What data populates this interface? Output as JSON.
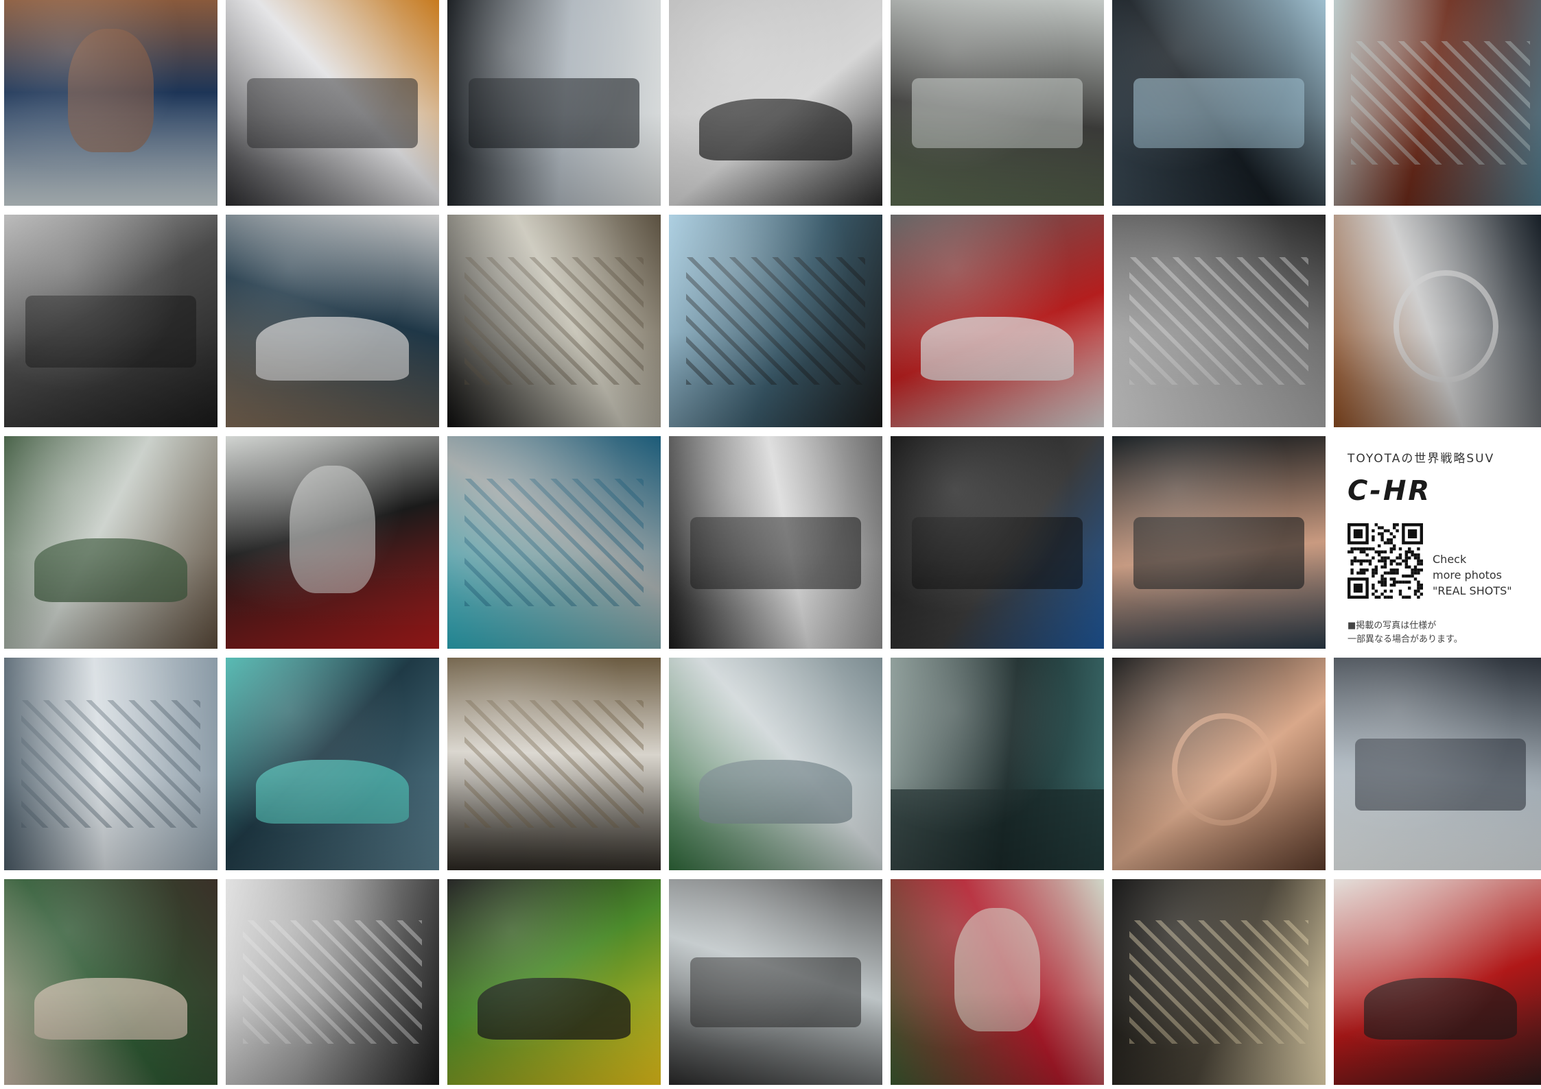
{
  "info_panel": {
    "tagline": "TOYOTAの世界戦略SUV",
    "logo_text": "C-HR",
    "check_lines": [
      "Check",
      "more photos",
      "\"REAL SHOTS\""
    ],
    "note_lines": [
      "■掲載の写真は仕様が",
      "一部異なる場合があります。"
    ]
  },
  "photos": [
    {
      "name": "photo-bearded-man",
      "colors": [
        "#c9d3d6",
        "#1d3557",
        "#8a5a3c"
      ],
      "motif": "portrait"
    },
    {
      "name": "photo-dashboard-airbag-vent",
      "colors": [
        "#2b2b2e",
        "#e2e2e4",
        "#c77a1e"
      ],
      "motif": "interior"
    },
    {
      "name": "photo-driver-window",
      "colors": [
        "#101418",
        "#aeb6bd",
        "#d9dcdc"
      ],
      "motif": "interior"
    },
    {
      "name": "photo-white-chr-open-hatch",
      "colors": [
        "#bdbdbd",
        "#d6d6d6",
        "#2a2a2a"
      ],
      "motif": "car"
    },
    {
      "name": "photo-door-frame-sky",
      "colors": [
        "#c3c8c5",
        "#3c3c3a",
        "#5a6a4f"
      ],
      "motif": "interior"
    },
    {
      "name": "photo-navigation-display",
      "colors": [
        "#9fbfcf",
        "#151c22",
        "#3b4a55"
      ],
      "motif": "interior"
    },
    {
      "name": "photo-wet-hood",
      "colors": [
        "#4d7b8e",
        "#6b2a1a",
        "#b9c8c8"
      ],
      "motif": "detail"
    },
    {
      "name": "photo-steering-wheel",
      "colors": [
        "#1a1a1a",
        "#4a4a4a",
        "#b8b8b8"
      ],
      "motif": "interior"
    },
    {
      "name": "photo-silver-chr-building",
      "colors": [
        "#7f6a55",
        "#1f3747",
        "#c8c8c8"
      ],
      "motif": "car"
    },
    {
      "name": "photo-dotted-headliner",
      "colors": [
        "#0e0e0e",
        "#c8c5b8",
        "#5a5040"
      ],
      "motif": "detail"
    },
    {
      "name": "photo-sky-reflection-hood",
      "colors": [
        "#a9cde0",
        "#3a5a6a",
        "#1a1a1a"
      ],
      "motif": "detail"
    },
    {
      "name": "photo-red-chr-front",
      "colors": [
        "#5c5c5c",
        "#b41e1e",
        "#d6d6d6"
      ],
      "motif": "car"
    },
    {
      "name": "photo-diamond-texture",
      "colors": [
        "#2a2a2a",
        "#8a8a8a",
        "#dcdcdc"
      ],
      "motif": "detail"
    },
    {
      "name": "photo-toyota-emblem-bronze",
      "colors": [
        "#101820",
        "#c9c9c9",
        "#8a4a20"
      ],
      "motif": "emblem"
    },
    {
      "name": "photo-chr-house-front",
      "colors": [
        "#5a4a3a",
        "#c9cfc9",
        "#3f5a3f"
      ],
      "motif": "car"
    },
    {
      "name": "photo-chihuahua",
      "colors": [
        "#b31b1b",
        "#1a1a1a",
        "#cfd2cf"
      ],
      "motif": "portrait"
    },
    {
      "name": "photo-sunglasses-hood",
      "colors": [
        "#2aa8b8",
        "#9fa6a6",
        "#1c5b78"
      ],
      "motif": "detail"
    },
    {
      "name": "photo-climate-controls",
      "colors": [
        "#1a1a1a",
        "#dcdcdc",
        "#6a6a6a"
      ],
      "motif": "interior"
    },
    {
      "name": "photo-start-button",
      "colors": [
        "#0f0f0f",
        "#3a3a3a",
        "#1f5aa0"
      ],
      "motif": "interior"
    },
    {
      "name": "photo-hand-shifter",
      "colors": [
        "#0d1418",
        "#c99a80",
        "#2a3a48"
      ],
      "motif": "interior"
    },
    {
      "name": "info-panel",
      "colors": [],
      "motif": "info"
    },
    {
      "name": "photo-roof-spoiler",
      "colors": [
        "#8a9aa6",
        "#d8dee2",
        "#4a5a66"
      ],
      "motif": "detail"
    },
    {
      "name": "photo-blue-chr-front",
      "colors": [
        "#5a7f8f",
        "#1f3a46",
        "#4fb8b0"
      ],
      "motif": "car"
    },
    {
      "name": "photo-side-mirror",
      "colors": [
        "#2a2620",
        "#d8d4cc",
        "#6a5a40"
      ],
      "motif": "detail"
    },
    {
      "name": "photo-silver-chr-glass-building",
      "colors": [
        "#2f6a3a",
        "#cfd6d8",
        "#7a8a8f"
      ],
      "motif": "car"
    },
    {
      "name": "photo-palm-trees-silhouette",
      "colors": [
        "#8a9a96",
        "#1a2a2a",
        "#3a6a6a"
      ],
      "motif": "scene"
    },
    {
      "name": "photo-heart-hands-emblem",
      "colors": [
        "#151515",
        "#d9a88a",
        "#5a3a2a"
      ],
      "motif": "emblem"
    },
    {
      "name": "photo-passenger-interior",
      "colors": [
        "#2a3038",
        "#aab4bc",
        "#e8ecec"
      ],
      "motif": "interior"
    },
    {
      "name": "photo-woman-driver-window",
      "colors": [
        "#3a3028",
        "#2f5a34",
        "#c8b8a8"
      ],
      "motif": "car"
    },
    {
      "name": "photo-engine-bay",
      "colors": [
        "#1a1a1a",
        "#9a9a9a",
        "#e0e0e0"
      ],
      "motif": "detail"
    },
    {
      "name": "photo-yellow-chr-mirror",
      "colors": [
        "#e8c21a",
        "#4a8a2a",
        "#1a1a1a"
      ],
      "motif": "car"
    },
    {
      "name": "photo-interior-wheel-screen",
      "colors": [
        "#2a2a2a",
        "#bfc6c8",
        "#5a5a5a"
      ],
      "motif": "interior"
    },
    {
      "name": "photo-woman-open-hatch",
      "colors": [
        "#3a5a30",
        "#b01a2a",
        "#cfd6c8"
      ],
      "motif": "portrait"
    },
    {
      "name": "photo-headlight-closeup",
      "colors": [
        "#0d0d0d",
        "#4a4438",
        "#e8d8b0"
      ],
      "motif": "detail"
    },
    {
      "name": "photo-red-chr-side",
      "colors": [
        "#e2ddd8",
        "#b01818",
        "#2a1a1a"
      ],
      "motif": "car"
    }
  ]
}
